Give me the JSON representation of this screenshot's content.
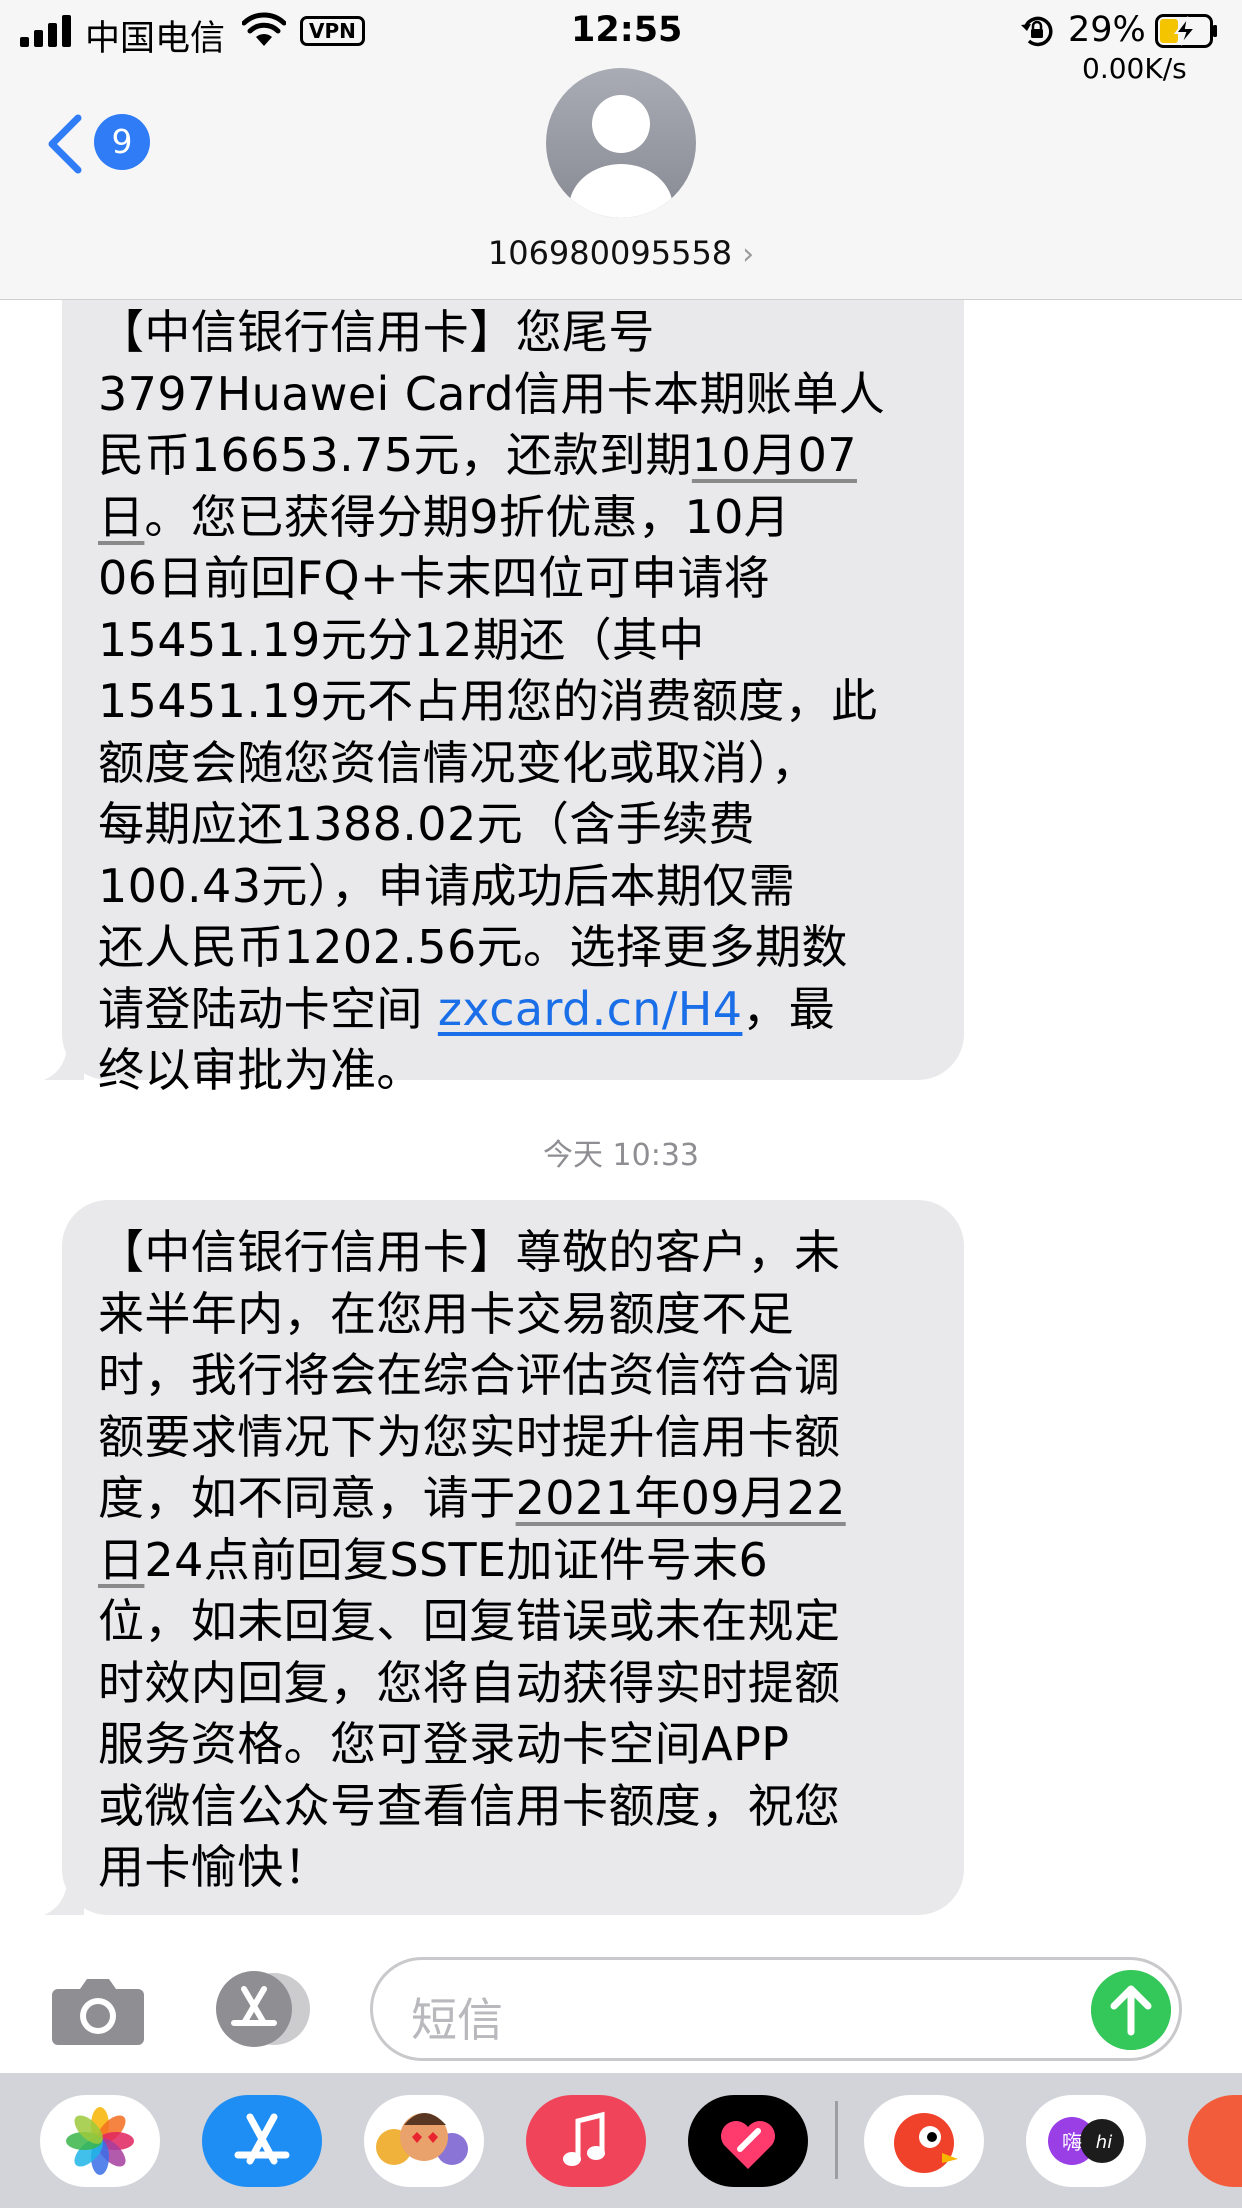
{
  "status_bar": {
    "carrier": "中国电信",
    "vpn": "VPN",
    "time": "12:55",
    "battery_percent": "29%",
    "net_speed": "0.00K/s"
  },
  "header": {
    "unread_count": "9",
    "contact_number": "106980095558",
    "chevron": "›"
  },
  "messages": [
    {
      "sender": "incoming",
      "text_part1": "【中信银行信用卡】您尾号\n3797Huawei Card信用卡本期账单人\n民币16653.75元，还款到期",
      "date_link": "10月07\n日",
      "text_part2": "。您已获得分期9折优惠，10月\n06日前回FQ+卡末四位可申请将\n15451.19元分12期还（其中\n15451.19元不占用您的消费额度，此\n额度会随您资信情况变化或取消），\n每期应还1388.02元（含手续费\n100.43元），申请成功后本期仅需\n还人民币1202.56元。选择更多期数\n请登陆动卡空间 ",
      "url": "zxcard.cn/H4",
      "text_part3": "，最\n终以审批为准。"
    },
    {
      "sender": "incoming",
      "text_part1": "【中信银行信用卡】尊敬的客户，未\n来半年内，在您用卡交易额度不足\n时，我行将会在综合评估资信符合调\n额要求情况下为您实时提升信用卡额\n度，如不同意，请于",
      "date_link": "2021年09月22\n日",
      "text_part2": "24点前回复SSTE加证件号末6\n位，如未回复、回复错误或未在规定\n时效内回复，您将自动获得实时提额\n服务资格。您可登录动卡空间APP\n或微信公众号查看信用卡额度，祝您\n用卡愉快！"
    }
  ],
  "timestamp": "今天 10:33",
  "input": {
    "placeholder": "短信"
  },
  "app_drawer": {
    "apps": [
      "photos-app-icon",
      "app-store-app-icon",
      "memoji-app-icon",
      "music-app-icon",
      "fitness-heart-app-icon",
      "bird-app-icon",
      "hi-chat-app-icon",
      "partial-app-icon"
    ],
    "hi_label_1": "嗨",
    "hi_label_2": "hi"
  },
  "colors": {
    "accent_blue": "#2f7cf6",
    "bubble_gray": "#e9e9eb",
    "send_green": "#34c759",
    "link_blue": "#1a6ee8"
  }
}
